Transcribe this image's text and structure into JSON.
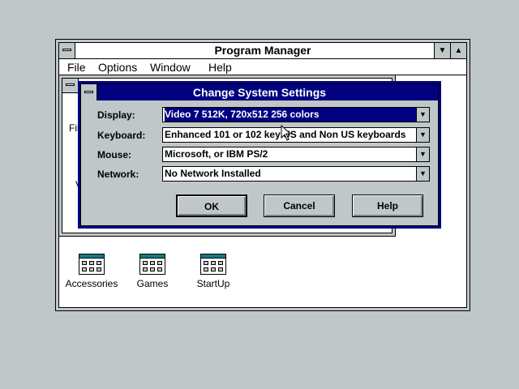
{
  "program_manager": {
    "title": "Program Manager",
    "menu": [
      "File",
      "Options",
      "Window",
      "Help"
    ],
    "child_partial_text": [
      "Fil",
      "V"
    ],
    "icons": [
      {
        "label": "Accessories"
      },
      {
        "label": "Games"
      },
      {
        "label": "StartUp"
      }
    ]
  },
  "dialog": {
    "title": "Change System Settings",
    "fields": [
      {
        "label": "Display:",
        "value": "Video 7 512K, 720x512 256 colors"
      },
      {
        "label": "Keyboard:",
        "value": "Enhanced 101 or 102 key US and Non US keyboards"
      },
      {
        "label": "Mouse:",
        "value": "Microsoft, or IBM PS/2"
      },
      {
        "label": "Network:",
        "value": "No Network Installed"
      }
    ],
    "buttons": {
      "ok": "OK",
      "cancel": "Cancel",
      "help": "Help"
    }
  },
  "colors": {
    "desktop": "#c0c7c8",
    "title_active": "#000081",
    "icon_accent": "#0b7d86"
  },
  "icons_semantic": [
    "system-menu-icon",
    "minimize-arrow-icon",
    "maximize-arrow-icon",
    "dropdown-arrow-icon",
    "program-group-icon",
    "mouse-pointer-icon"
  ]
}
